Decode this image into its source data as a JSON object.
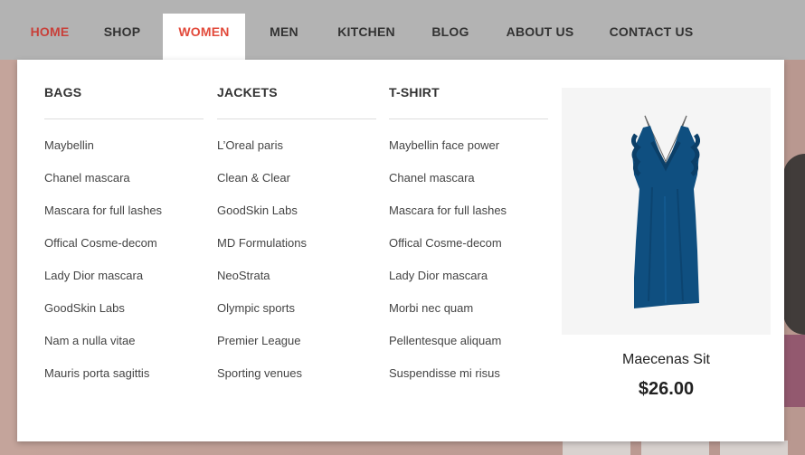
{
  "nav": {
    "items": [
      {
        "label": "HOME"
      },
      {
        "label": "SHOP"
      },
      {
        "label": "WOMEN"
      },
      {
        "label": "MEN"
      },
      {
        "label": "KITCHEN"
      },
      {
        "label": "BLOG"
      },
      {
        "label": "ABOUT US"
      },
      {
        "label": "CONTACT US"
      }
    ],
    "active": "WOMEN"
  },
  "megamenu": {
    "columns": [
      {
        "title": "BAGS",
        "links": [
          "Maybellin",
          "Chanel mascara",
          "Mascara for full lashes",
          "Offical Cosme-decom",
          "Lady Dior mascara",
          "GoodSkin Labs",
          "Nam a nulla vitae",
          "Mauris porta sagittis"
        ]
      },
      {
        "title": "JACKETS",
        "links": [
          "L’Oreal paris",
          "Clean & Clear",
          "GoodSkin Labs",
          "MD Formulations",
          "NeoStrata",
          "Olympic sports",
          "Premier League",
          "Sporting venues"
        ]
      },
      {
        "title": "T-SHIRT",
        "links": [
          "Maybellin face power",
          "Chanel mascara",
          "Mascara for full lashes",
          "Offical Cosme-decom",
          "Lady Dior mascara",
          "Morbi nec quam",
          "Pellentesque aliquam",
          "Suspendisse mi risus"
        ]
      }
    ],
    "product": {
      "name": "Maecenas Sit",
      "price": "$26.00",
      "image": "blue-dress"
    }
  },
  "colors": {
    "accent": "#e24a3b",
    "home": "#c8403a",
    "nav_bg": "#b3b3b3",
    "dress": "#0f4f80"
  }
}
